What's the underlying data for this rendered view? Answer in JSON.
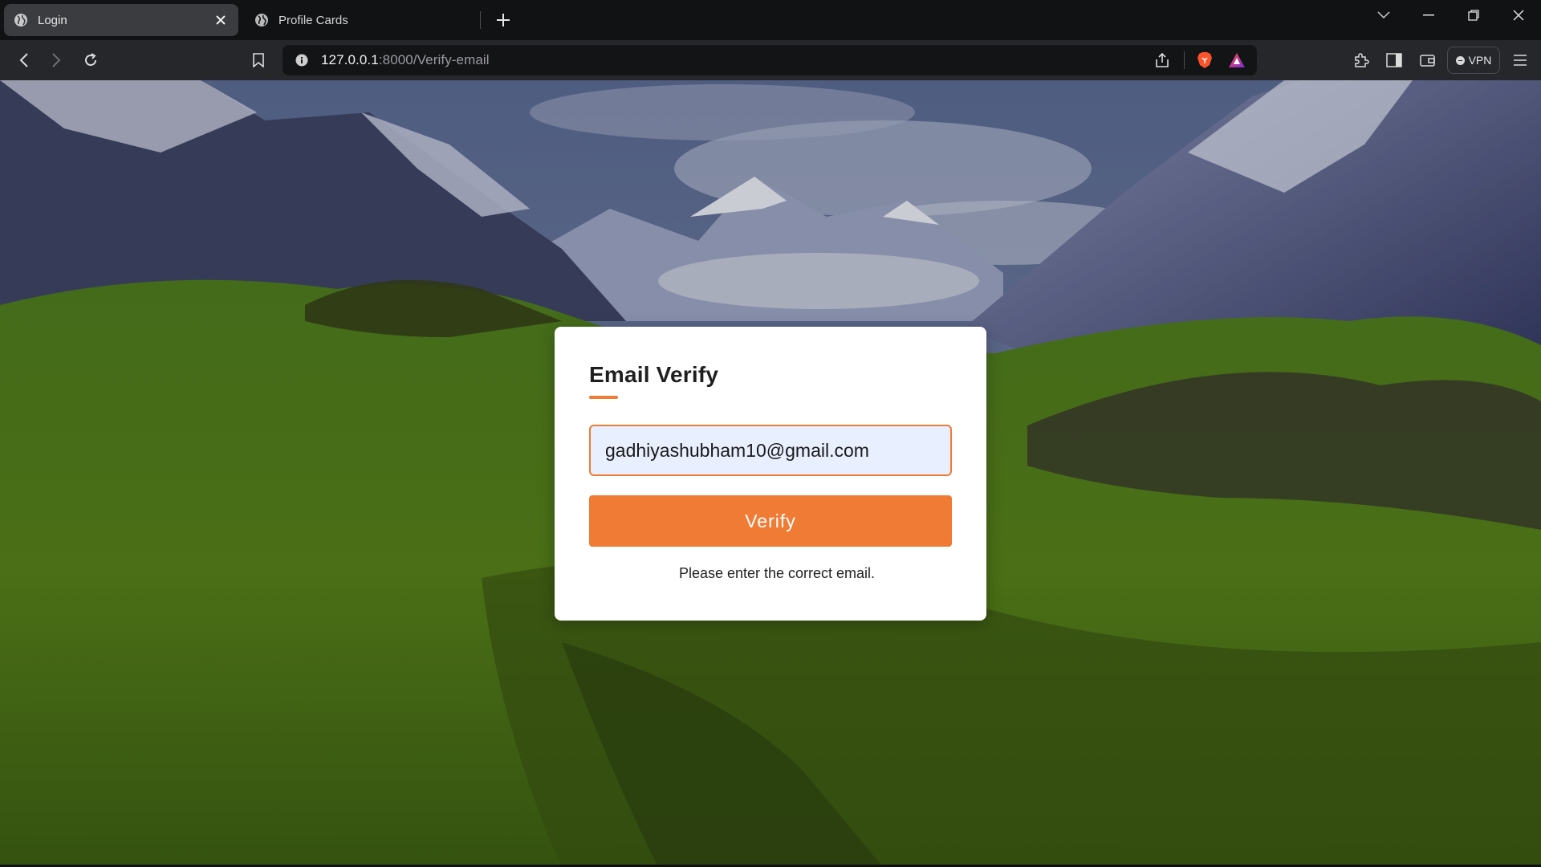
{
  "browser": {
    "tabs": [
      {
        "label": "Login",
        "active": true,
        "icon": "globe-icon"
      },
      {
        "label": "Profile Cards",
        "active": false,
        "icon": "globe-icon"
      }
    ],
    "url": {
      "host": "127.0.0.1",
      "rest": ":8000/Verify-email"
    },
    "vpn_label": "VPN",
    "colors": {
      "tabbar": "#111214",
      "toolbar": "#26272b",
      "urlbar": "#131416"
    }
  },
  "card": {
    "title": "Email Verify",
    "email_value": "gadhiyashubham10@gmail.com",
    "button_label": "Verify",
    "message": "Please enter the correct email.",
    "colors": {
      "accent": "#ef7b35",
      "input_bg": "#e8efff",
      "card_bg": "#ffffff"
    }
  }
}
